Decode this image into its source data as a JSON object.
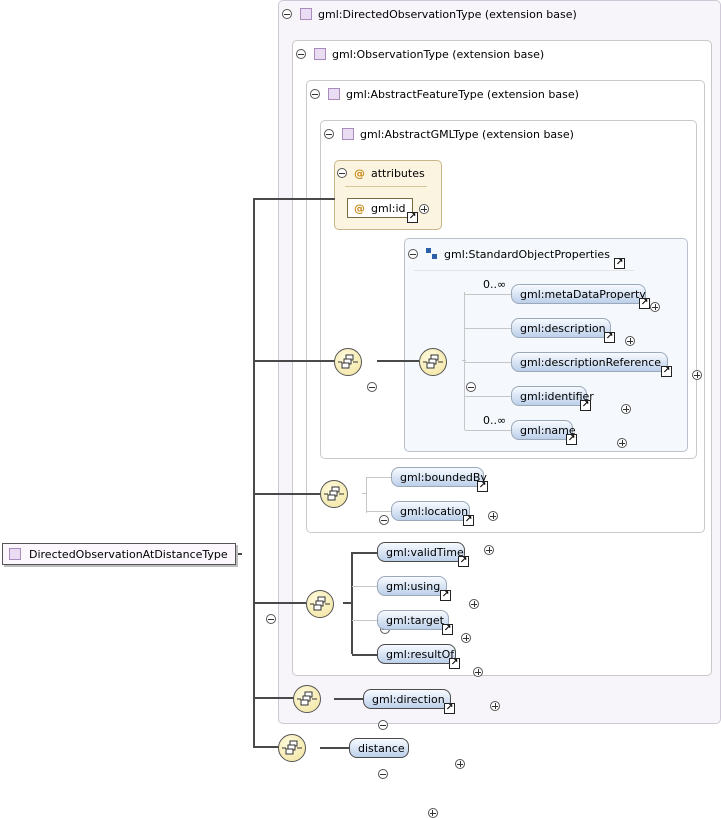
{
  "root": {
    "label": "DirectedObservationAtDistanceType"
  },
  "types": {
    "directed_observation": "gml:DirectedObservationType (extension base)",
    "observation": "gml:ObservationType (extension base)",
    "abstract_feature": "gml:AbstractFeatureType (extension base)",
    "abstract_gml": "gml:AbstractGMLType (extension base)"
  },
  "attributes": {
    "title": "attributes",
    "items": [
      {
        "name": "gml:id"
      }
    ]
  },
  "group": {
    "label": "gml:StandardObjectProperties"
  },
  "group_elements": [
    {
      "name": "gml:metaDataProperty",
      "multiplicity": "0..∞"
    },
    {
      "name": "gml:description",
      "multiplicity": ""
    },
    {
      "name": "gml:descriptionReference",
      "multiplicity": ""
    },
    {
      "name": "gml:identifier",
      "multiplicity": ""
    },
    {
      "name": "gml:name",
      "multiplicity": "0..∞"
    }
  ],
  "feature_elements": [
    {
      "name": "gml:boundedBy"
    },
    {
      "name": "gml:location"
    }
  ],
  "observation_elements": [
    {
      "name": "gml:validTime"
    },
    {
      "name": "gml:using"
    },
    {
      "name": "gml:target"
    },
    {
      "name": "gml:resultOf"
    }
  ],
  "directed_elements": [
    {
      "name": "gml:direction"
    }
  ],
  "own_elements": [
    {
      "name": "distance"
    }
  ],
  "colors": {
    "type_fill": "#eadcf3",
    "element_fill": "#bcd0ea",
    "compositor_fill": "#f1e29a",
    "attribute_fill": "#fbf4e0"
  }
}
